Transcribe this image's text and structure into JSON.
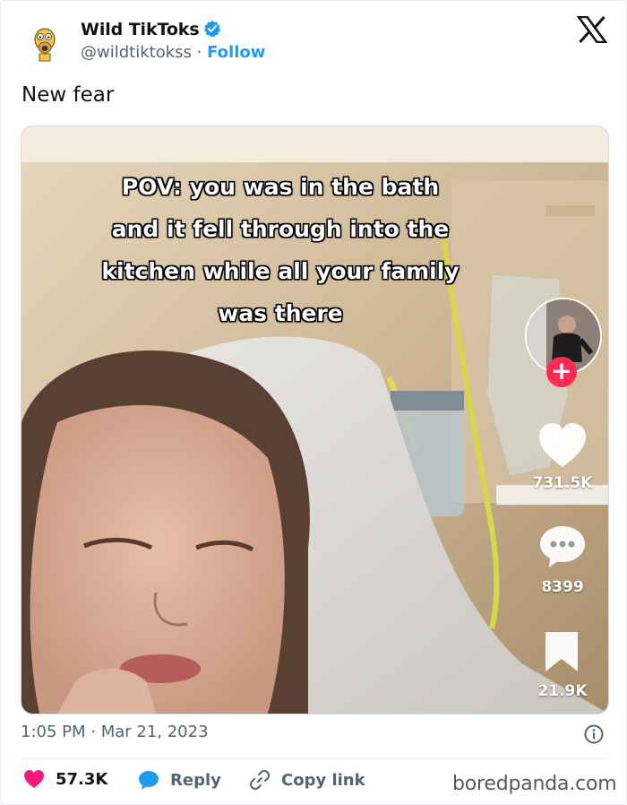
{
  "account": {
    "name": "Wild TikToks",
    "handle": "@wildtiktokss",
    "separator": "·",
    "follow_label": "Follow"
  },
  "tweet": {
    "text": "New fear"
  },
  "video": {
    "caption_lines": [
      "POV: you was in the bath",
      "and it fell through into the",
      "kitchen while all your family",
      "was there"
    ],
    "likes": "731.5K",
    "comments": "8399",
    "saves": "21.9K",
    "plus": "+"
  },
  "meta": {
    "timestamp": "1:05 PM · Mar 21, 2023"
  },
  "actions": {
    "likes": "57.3K",
    "reply": "Reply",
    "copy_link": "Copy link"
  },
  "watermark": "boredpanda.com",
  "colors": {
    "accent": "#1d9bf0",
    "like": "#f91880",
    "tiktok_red": "#fe2c55",
    "muted": "#536471"
  }
}
